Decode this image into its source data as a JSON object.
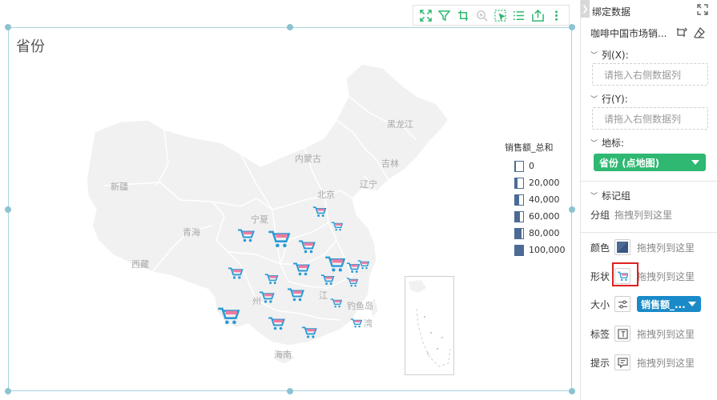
{
  "chart": {
    "title": "省份"
  },
  "toolbar": {
    "icons": [
      "fullscreen-icon",
      "filter-icon",
      "drill-icon",
      "zoom-icon",
      "select-icon",
      "list-icon",
      "export-icon",
      "more-icon"
    ]
  },
  "map": {
    "province_labels": [
      {
        "name": "黑龙江"
      },
      {
        "name": "内蒙古"
      },
      {
        "name": "吉林"
      },
      {
        "name": "新疆"
      },
      {
        "name": "辽宁"
      },
      {
        "name": "北京"
      },
      {
        "name": "宁夏"
      },
      {
        "name": "青海"
      },
      {
        "name": "西藏"
      },
      {
        "name": "江"
      },
      {
        "name": "钓鱼岛"
      },
      {
        "name": "海南"
      },
      {
        "name": "州"
      },
      {
        "name": "湾"
      }
    ]
  },
  "legend": {
    "title": "销售额_总和",
    "items": [
      {
        "label": "0",
        "level": 0.1
      },
      {
        "label": "20,000",
        "level": 0.28
      },
      {
        "label": "40,000",
        "level": 0.45
      },
      {
        "label": "60,000",
        "level": 0.62
      },
      {
        "label": "80,000",
        "level": 0.8
      },
      {
        "label": "100,000",
        "level": 1.0
      }
    ],
    "color": "#4b6a95"
  },
  "panel": {
    "title": "绑定数据",
    "dataset_name": "咖啡中国市场销...",
    "columns": {
      "label": "列(X):",
      "placeholder": "请拖入右侧数据列"
    },
    "rows": {
      "label": "行(Y):",
      "placeholder": "请拖入右侧数据列"
    },
    "geo": {
      "label": "地标:",
      "value": "省份 (点地图)"
    },
    "marks": {
      "label": "标记组",
      "group": {
        "label": "分组",
        "hint": "拖拽列到这里"
      },
      "color": {
        "label": "颜色",
        "hint": "拖拽列到这里"
      },
      "shape": {
        "label": "形状",
        "hint": "拖拽列到这里"
      },
      "size": {
        "label": "大小",
        "value": "销售额_..."
      },
      "tag": {
        "label": "标签",
        "hint": "拖拽列到这里"
      },
      "tip": {
        "label": "提示",
        "hint": "拖拽列到这里"
      }
    }
  },
  "colors": {
    "frame": "#a9d4de",
    "geo_pill": "#2eb872",
    "size_pill": "#1a8ac8",
    "cart_blue": "#2a9ad6",
    "cart_pink": "#f07aa0",
    "highlight": "#e02020"
  }
}
